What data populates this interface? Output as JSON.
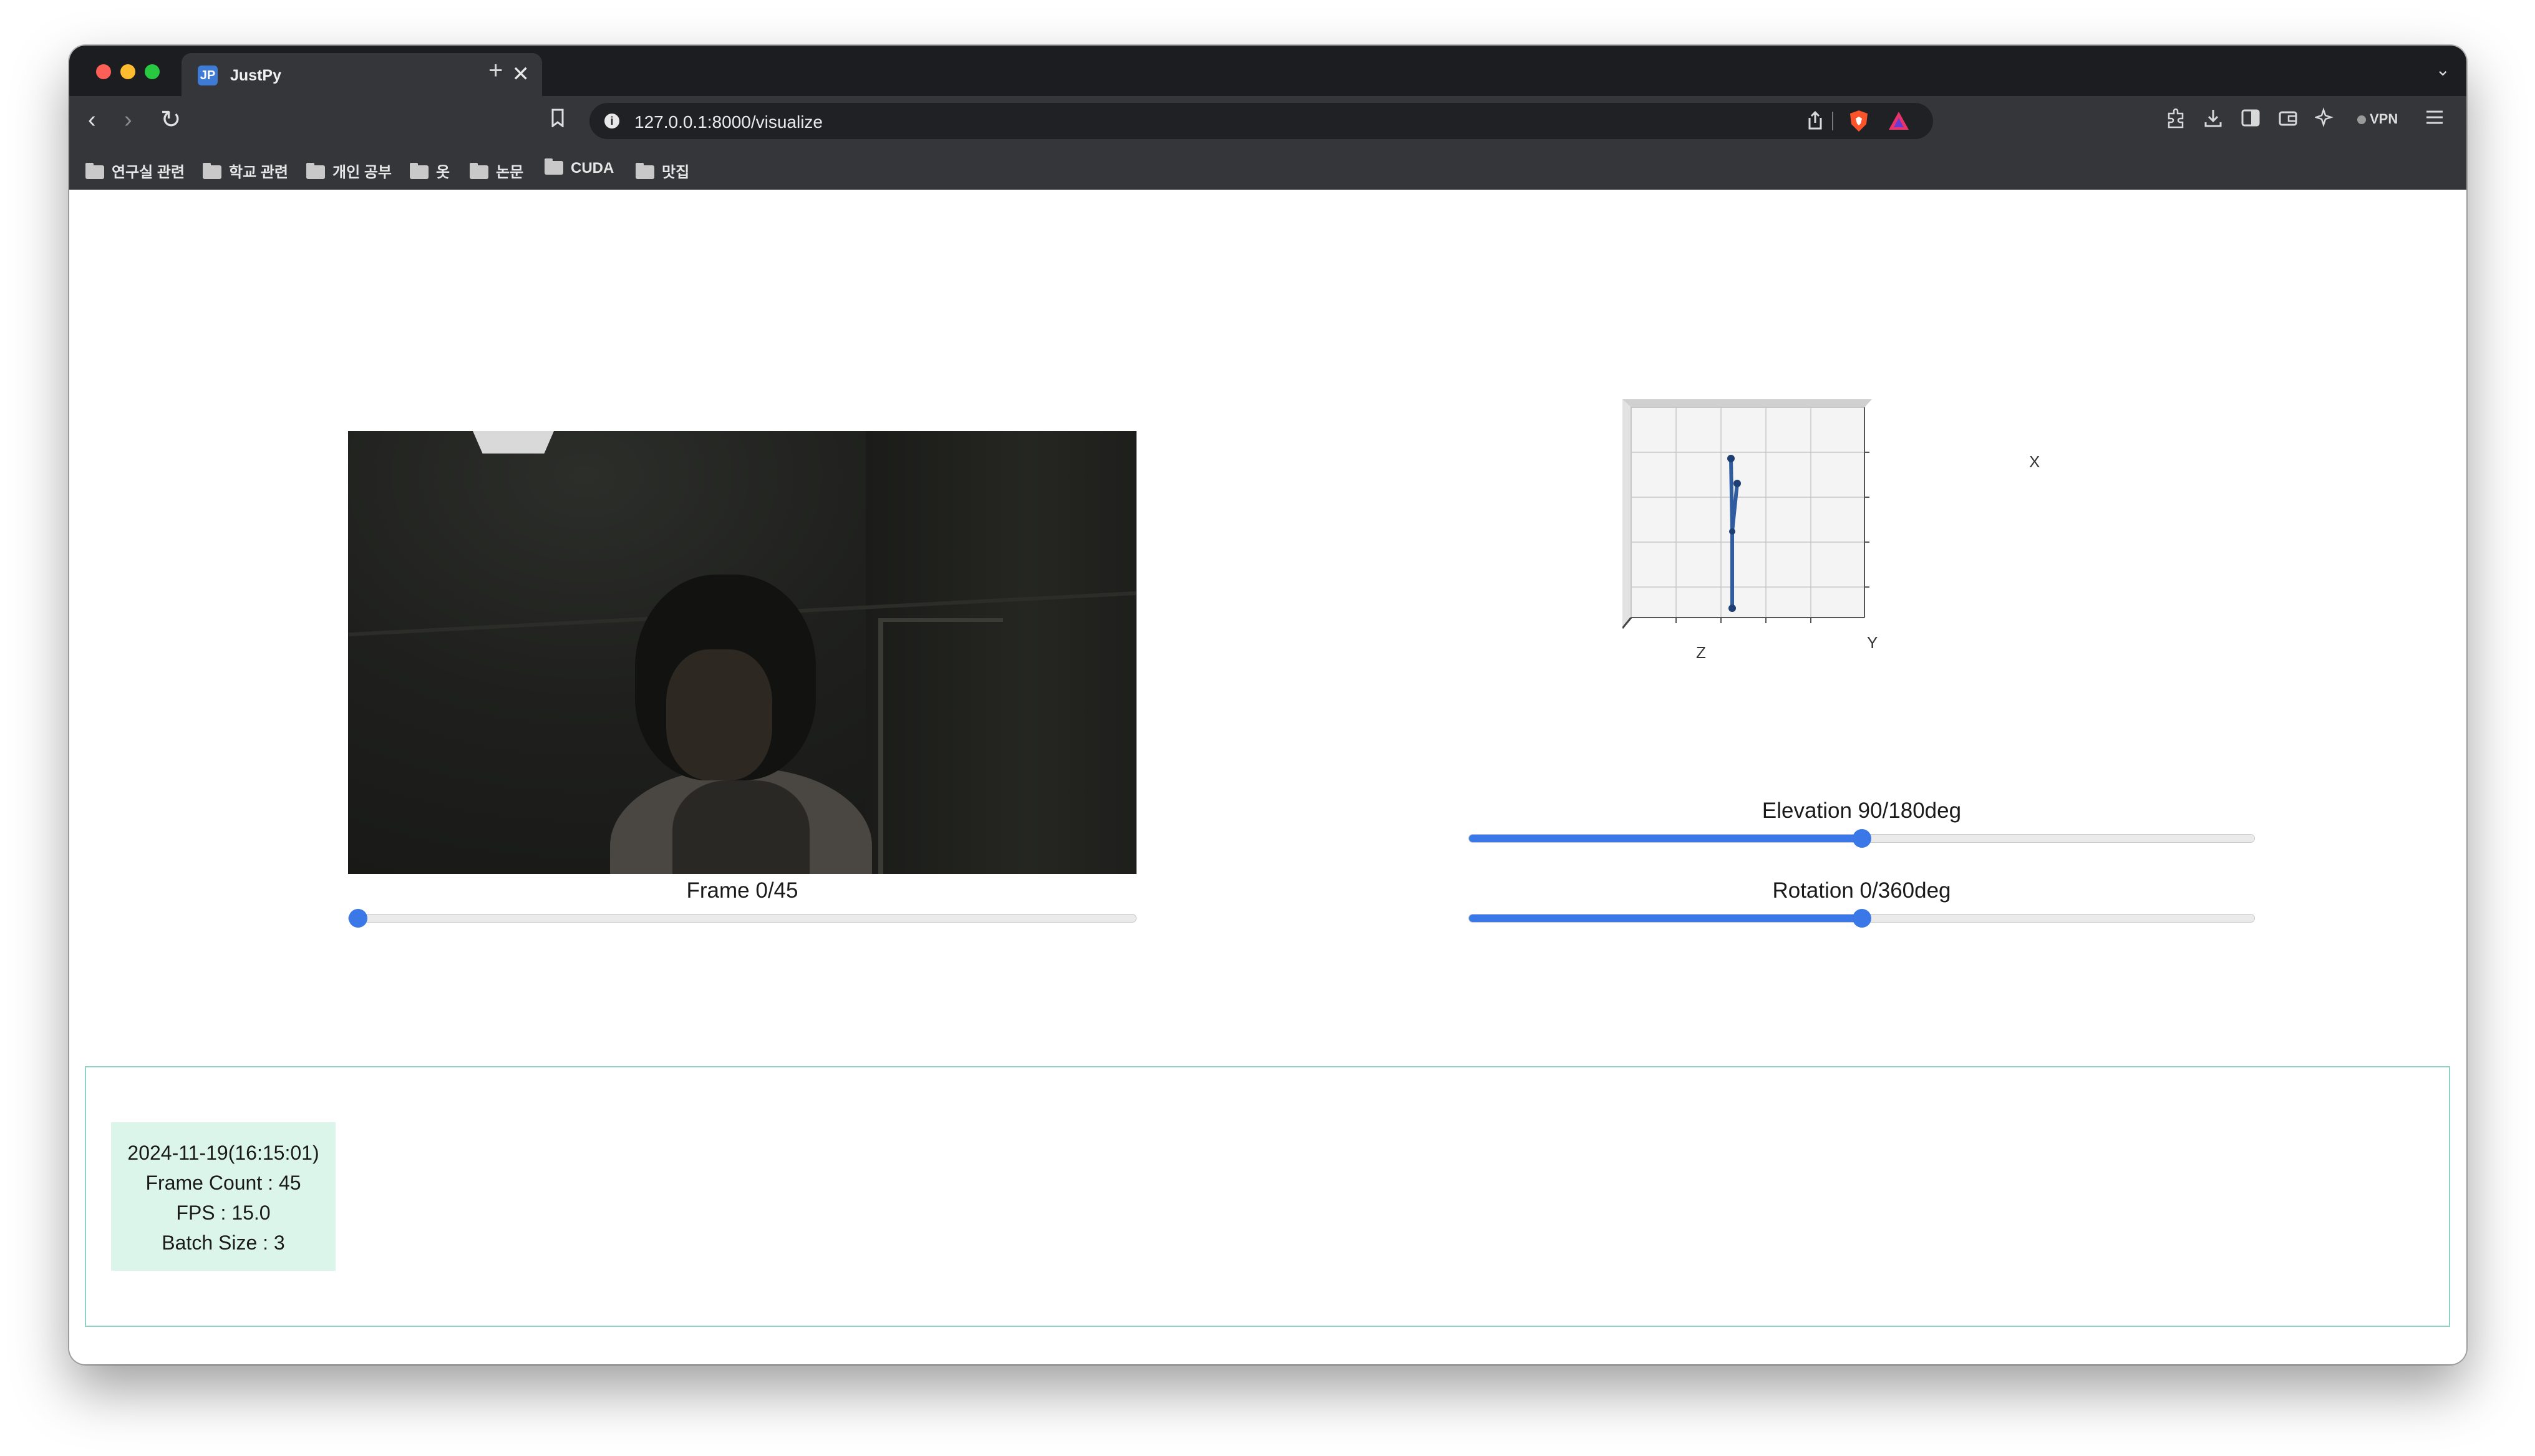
{
  "browser": {
    "tab": {
      "favicon": "JP",
      "title": "JustPy",
      "close_glyph": "✕"
    },
    "new_tab_glyph": "+",
    "tab_menu_glyph": "⌄",
    "url": "127.0.0.1:8000/visualize",
    "vpn_label": "VPN",
    "nav": {
      "back_glyph": "‹",
      "forward_glyph": "›",
      "reload_glyph": "↻"
    },
    "icons": [
      "bookmark-icon",
      "site-info-icon",
      "share-icon",
      "brave-shields-icon",
      "brave-rewards-icon",
      "extensions-icon",
      "downloads-icon",
      "sidebar-icon",
      "wallet-icon",
      "leo-ai-icon",
      "vpn-icon",
      "menu-icon"
    ]
  },
  "bookmarks": [
    {
      "label": "연구실 관련"
    },
    {
      "label": "학교 관련"
    },
    {
      "label": "개인 공부"
    },
    {
      "label": "옷"
    },
    {
      "label": "논문"
    },
    {
      "label": "CUDA"
    },
    {
      "label": "맛집"
    }
  ],
  "video": {
    "frame_label": "Frame 0/45",
    "frame_value": 0,
    "frame_max": 45
  },
  "plot3d": {
    "axis_x": "X",
    "axis_y": "Y",
    "axis_z": "Z",
    "elevation_label": "Elevation 90/180deg",
    "elevation_value": 90,
    "elevation_max": 180,
    "rotation_label": "Rotation 0/360deg",
    "rotation_value": 0,
    "rotation_fill_fraction": 0.5,
    "line_color": "#2e5c9e"
  },
  "info": {
    "datetime": "2024-11-19(16:15:01)",
    "frame_count": "Frame Count : 45",
    "fps": "FPS : 15.0",
    "batch_size": "Batch Size : 3"
  },
  "colors": {
    "accent": "#3b78e7",
    "panel_border": "#8fd3c5",
    "info_box_bg": "#dcf5ea"
  }
}
